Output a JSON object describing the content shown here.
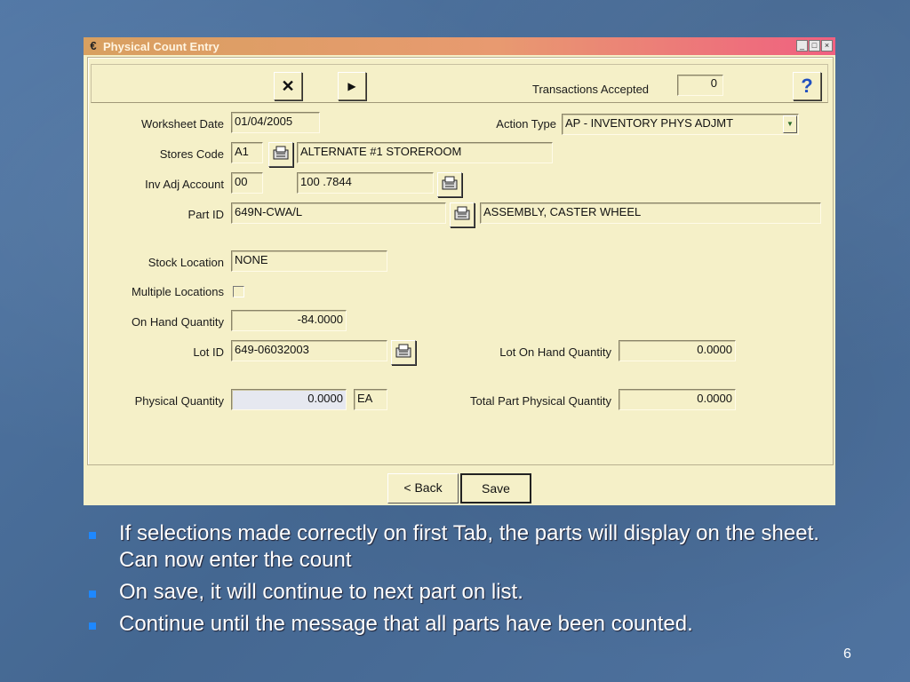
{
  "window": {
    "title": "Physical Count Entry",
    "app_icon": "€",
    "minimize": "_",
    "maximize": "□",
    "close": "×"
  },
  "toolbar": {
    "close_icon": "✕",
    "next_icon": "▶",
    "transactions_label": "Transactions Accepted",
    "transactions_value": "0",
    "help_icon": "?"
  },
  "form": {
    "worksheet_date_label": "Worksheet Date",
    "worksheet_date": "01/04/2005",
    "action_type_label": "Action Type",
    "action_type": "AP - INVENTORY PHYS ADJMT",
    "stores_code_label": "Stores Code",
    "stores_code": "A1",
    "stores_desc": "ALTERNATE #1 STOREROOM",
    "inv_adj_label": "Inv Adj Account",
    "inv_adj_code": "00",
    "inv_adj_account": "100 .7844",
    "part_id_label": "Part ID",
    "part_id": "649N-CWA/L",
    "part_desc": "ASSEMBLY, CASTER WHEEL",
    "stock_location_label": "Stock Location",
    "stock_location": "NONE",
    "multiple_locations_label": "Multiple Locations",
    "on_hand_label": "On Hand Quantity",
    "on_hand": "-84.0000",
    "lot_id_label": "Lot ID",
    "lot_id": "649-06032003",
    "lot_on_hand_label": "Lot On Hand Quantity",
    "lot_on_hand": "0.0000",
    "physical_qty_label": "Physical Quantity",
    "physical_qty": "0.0000",
    "uom": "EA",
    "total_physical_label": "Total Part Physical Quantity",
    "total_physical": "0.0000"
  },
  "buttons": {
    "back": "< Back",
    "save": "Save"
  },
  "bullets": [
    "If selections made correctly on first Tab, the parts will display on the sheet. Can now enter the count",
    "On save, it will continue to next part on list.",
    "Continue until the message that all parts have been counted."
  ],
  "page_number": "6"
}
